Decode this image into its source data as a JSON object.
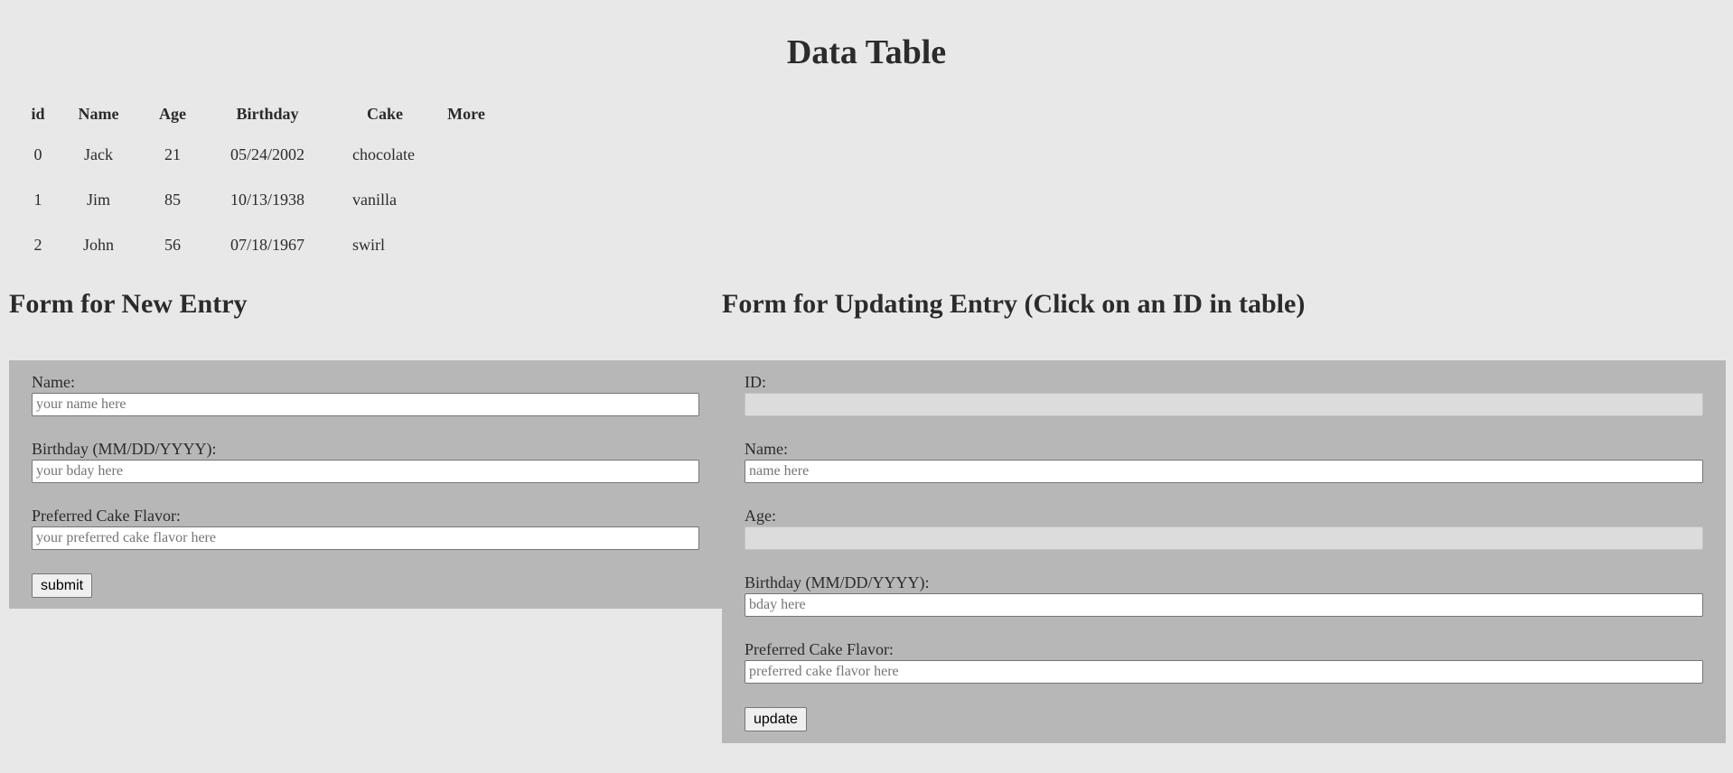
{
  "page": {
    "title": "Data Table"
  },
  "table": {
    "headers": [
      "id",
      "Name",
      "Age",
      "Birthday",
      "Cake",
      "More"
    ],
    "rows": [
      {
        "id": "0",
        "name": "Jack",
        "age": "21",
        "birthday": "05/24/2002",
        "cake": "chocolate"
      },
      {
        "id": "1",
        "name": "Jim",
        "age": "85",
        "birthday": "10/13/1938",
        "cake": "vanilla"
      },
      {
        "id": "2",
        "name": "John",
        "age": "56",
        "birthday": "07/18/1967",
        "cake": "swirl"
      }
    ]
  },
  "new_form": {
    "heading": "Form for New Entry",
    "name_label": "Name:",
    "name_placeholder": "your name here",
    "birthday_label": "Birthday (MM/DD/YYYY):",
    "birthday_placeholder": "your bday here",
    "cake_label": "Preferred Cake Flavor:",
    "cake_placeholder": "your preferred cake flavor here",
    "submit_label": "submit"
  },
  "update_form": {
    "heading": "Form for Updating Entry (Click on an ID in table)",
    "id_label": "ID:",
    "name_label": "Name:",
    "name_placeholder": "name here",
    "age_label": "Age:",
    "birthday_label": "Birthday (MM/DD/YYYY):",
    "birthday_placeholder": "bday here",
    "cake_label": "Preferred Cake Flavor:",
    "cake_placeholder": "preferred cake flavor here",
    "update_label": "update"
  },
  "colors": {
    "background": "#e8e8e8",
    "panel": "#b7b7b7",
    "disabled_input": "#dcdcdc"
  }
}
